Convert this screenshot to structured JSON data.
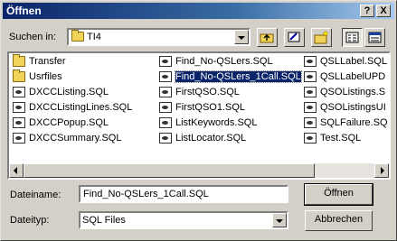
{
  "window": {
    "title": "Öffnen"
  },
  "titlebar": {
    "help_label": "?",
    "close_label": "X"
  },
  "lookin": {
    "label": "Suchen in:",
    "value": "TI4"
  },
  "toolbar": {
    "items": [
      "up-folder-icon",
      "desktop-icon",
      "new-folder-icon",
      "list-view-icon",
      "details-view-icon"
    ]
  },
  "files": {
    "columns": [
      [
        {
          "name": "Transfer",
          "type": "folder"
        },
        {
          "name": "Usrfiles",
          "type": "folder"
        },
        {
          "name": "DXCCListing.SQL",
          "type": "sql"
        },
        {
          "name": "DXCCListingLines.SQL",
          "type": "sql"
        },
        {
          "name": "DXCCPopup.SQL",
          "type": "sql"
        },
        {
          "name": "DXCCSummary.SQL",
          "type": "sql"
        }
      ],
      [
        {
          "name": "Find_No-QSLers.SQL",
          "type": "sql"
        },
        {
          "name": "Find_No-QSLers_1Call.SQL",
          "type": "sql",
          "selected": true
        },
        {
          "name": "FirstQSO.SQL",
          "type": "sql"
        },
        {
          "name": "FirstQSO1.SQL",
          "type": "sql"
        },
        {
          "name": "ListKeywords.SQL",
          "type": "sql"
        },
        {
          "name": "ListLocator.SQL",
          "type": "sql"
        }
      ],
      [
        {
          "name": "QSLLabel.SQL",
          "type": "sql"
        },
        {
          "name": "QSLLabelUPD",
          "type": "sql"
        },
        {
          "name": "QSOListings.S",
          "type": "sql"
        },
        {
          "name": "QSOListingsUI",
          "type": "sql"
        },
        {
          "name": "SQLFailure.SQ",
          "type": "sql"
        },
        {
          "name": "Test.SQL",
          "type": "sql"
        }
      ]
    ]
  },
  "filename": {
    "label": "Dateiname:",
    "value": "Find_No-QSLers_1Call.SQL"
  },
  "filetype": {
    "label": "Dateityp:",
    "value": "SQL Files"
  },
  "buttons": {
    "open": "Öffnen",
    "cancel": "Abbrechen"
  }
}
